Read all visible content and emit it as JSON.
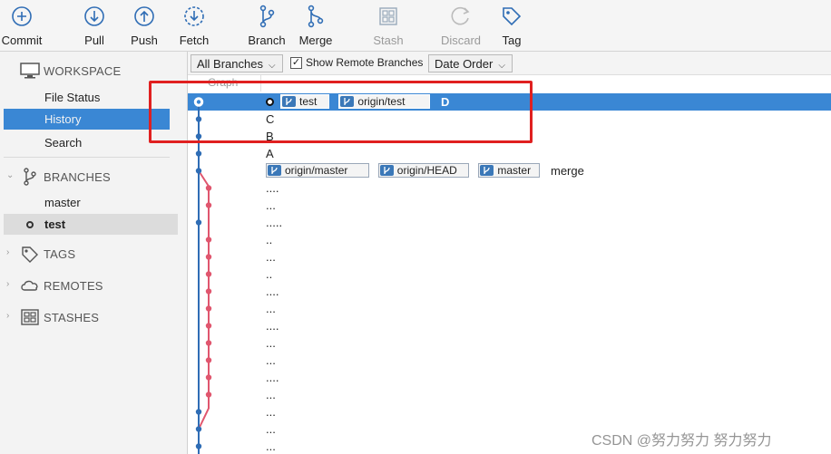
{
  "toolbar": {
    "buttons": [
      {
        "label": "Commit",
        "icon": "plus-circle-icon",
        "enabled": true
      },
      {
        "label": "Pull",
        "icon": "arrow-down-circle-icon",
        "enabled": true
      },
      {
        "label": "Push",
        "icon": "arrow-up-circle-icon",
        "enabled": true
      },
      {
        "label": "Fetch",
        "icon": "fetch-dashed-circle-icon",
        "enabled": true
      },
      {
        "label": "Branch",
        "icon": "branch-icon",
        "enabled": true
      },
      {
        "label": "Merge",
        "icon": "merge-icon",
        "enabled": true
      },
      {
        "label": "Stash",
        "icon": "stash-icon",
        "enabled": false
      },
      {
        "label": "Discard",
        "icon": "discard-icon",
        "enabled": false
      },
      {
        "label": "Tag",
        "icon": "tag-icon",
        "enabled": true
      }
    ]
  },
  "sidebar": {
    "workspace": {
      "title": "WORKSPACE",
      "items": [
        "File Status",
        "History",
        "Search"
      ],
      "selected": "History"
    },
    "branches": {
      "title": "BRANCHES",
      "items": [
        "master",
        "test"
      ],
      "current": "test"
    },
    "tags": {
      "title": "TAGS"
    },
    "remotes": {
      "title": "REMOTES"
    },
    "stashes": {
      "title": "STASHES"
    }
  },
  "filterbar": {
    "branches_dropdown": "All Branches",
    "show_remote_label": "Show Remote Branches",
    "show_remote_checked": true,
    "order_dropdown": "Date Order"
  },
  "graph": {
    "column_header": "Graph",
    "rows": [
      {
        "message": "D",
        "selected": true,
        "head": true,
        "refs": [
          "test",
          "origin/test"
        ]
      },
      {
        "message": "C",
        "refs": []
      },
      {
        "message": "B",
        "refs": []
      },
      {
        "message": "A",
        "refs": []
      },
      {
        "message": "merge",
        "refs": [
          "origin/master",
          "origin/HEAD",
          "master"
        ]
      },
      {
        "message": "....",
        "refs": []
      },
      {
        "message": "...",
        "refs": []
      },
      {
        "message": ".....",
        "refs": []
      },
      {
        "message": "..",
        "refs": []
      },
      {
        "message": "...",
        "refs": []
      },
      {
        "message": "..",
        "refs": []
      },
      {
        "message": "....",
        "refs": []
      },
      {
        "message": "...",
        "refs": []
      },
      {
        "message": "....",
        "refs": []
      },
      {
        "message": "...",
        "refs": []
      },
      {
        "message": "...",
        "refs": []
      },
      {
        "message": "....",
        "refs": []
      },
      {
        "message": "...",
        "refs": []
      },
      {
        "message": "...",
        "refs": []
      },
      {
        "message": "...",
        "refs": []
      },
      {
        "message": "...",
        "refs": []
      }
    ]
  },
  "colors": {
    "accent": "#3a87d4",
    "branch_main": "#2f6db5",
    "branch_side": "#e0566e",
    "highlight": "#e02020"
  },
  "watermark": "CSDN @努力努力 努力努力"
}
